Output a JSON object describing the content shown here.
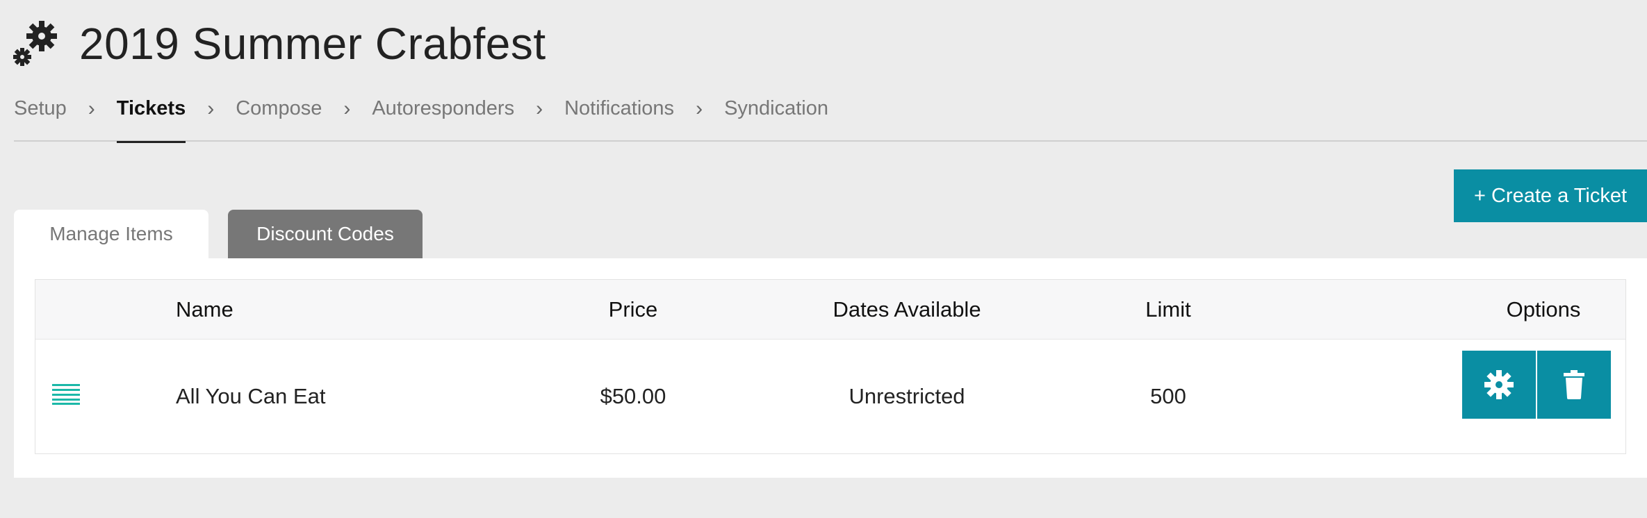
{
  "header": {
    "title": "2019 Summer Crabfest",
    "icon": "gears-icon"
  },
  "steps": [
    {
      "label": "Setup",
      "active": false
    },
    {
      "label": "Tickets",
      "active": true
    },
    {
      "label": "Compose",
      "active": false
    },
    {
      "label": "Autoresponders",
      "active": false
    },
    {
      "label": "Notifications",
      "active": false
    },
    {
      "label": "Syndication",
      "active": false
    }
  ],
  "step_separator": "›",
  "actions": {
    "create_label": "+ Create a Ticket"
  },
  "tabs": [
    {
      "label": "Manage Items",
      "selected": true
    },
    {
      "label": "Discount Codes",
      "selected": false
    }
  ],
  "table": {
    "columns": [
      "Name",
      "Price",
      "Dates Available",
      "Limit",
      "Options"
    ],
    "rows": [
      {
        "name": "All You Can Eat",
        "price": "$50.00",
        "dates": "Unrestricted",
        "limit": "500"
      }
    ]
  },
  "colors": {
    "accent": "#0a8ea3",
    "drag_handle": "#1cb8a8",
    "tab_inactive": "#777777"
  }
}
